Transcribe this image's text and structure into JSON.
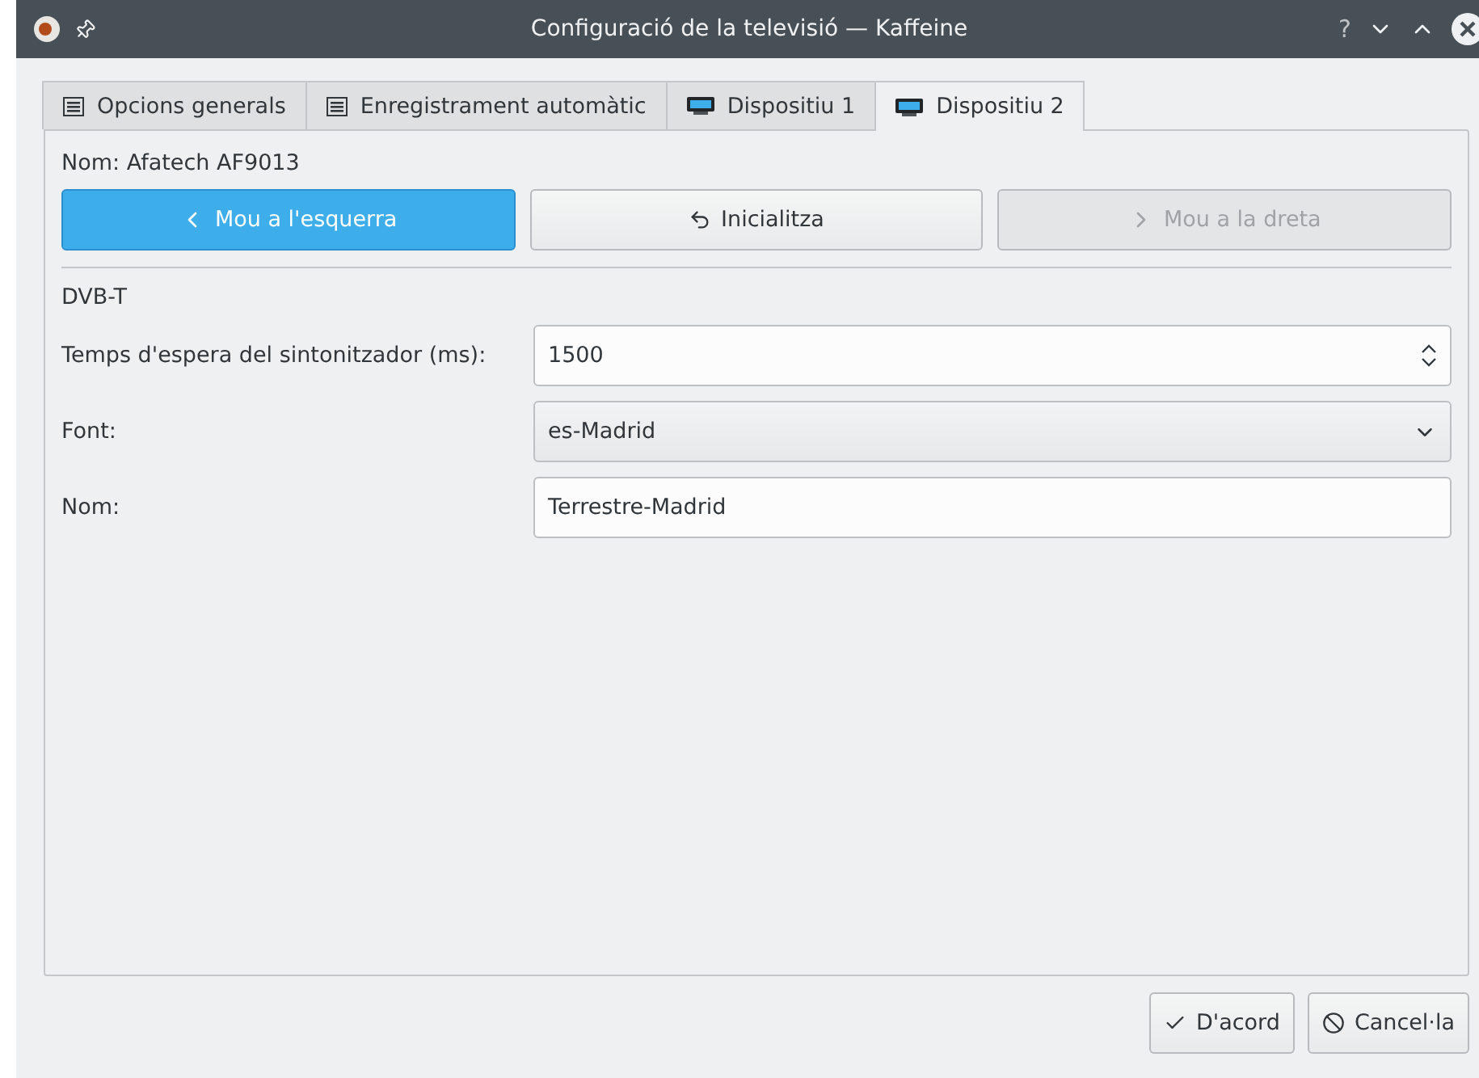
{
  "window": {
    "title": "Configuració de la televisió — Kaffeine",
    "controls": [
      "?"
    ]
  },
  "tabs": [
    {
      "label": "Opcions generals",
      "kind": "list",
      "selected": false
    },
    {
      "label": "Enregistrament automàtic",
      "kind": "list",
      "selected": false
    },
    {
      "label": "Dispositiu 1",
      "kind": "device",
      "selected": false
    },
    {
      "label": "Dispositiu 2",
      "kind": "device",
      "selected": true
    }
  ],
  "device_name": "Nom: Afatech AF9013",
  "move_buttons": [
    {
      "label": "Mou a l'esquerra",
      "kind": "left",
      "selected": true,
      "disabled": false
    },
    {
      "label": "Inicialitza",
      "kind": "reset",
      "selected": false,
      "disabled": false
    },
    {
      "label": "Mou a la dreta",
      "kind": "right",
      "selected": false,
      "disabled": true
    }
  ],
  "section": "DVB-T",
  "fields": [
    {
      "label": "Temps d'espera del sintonitzador (ms):",
      "kind": "spin",
      "value": "1500"
    },
    {
      "label": "Font:",
      "kind": "combo",
      "value": "es-Madrid"
    },
    {
      "label": "Nom:",
      "kind": "text",
      "value": "Terrestre-Madrid"
    }
  ],
  "dialog_buttons": [
    {
      "label": "D'acord",
      "kind": "ok"
    },
    {
      "label": "Cancel·la",
      "kind": "cancel"
    }
  ]
}
